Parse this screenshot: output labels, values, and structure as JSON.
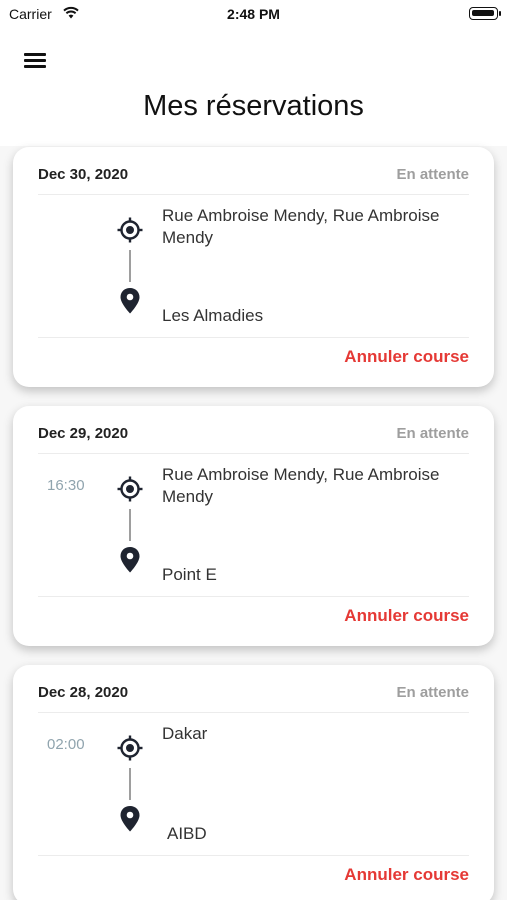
{
  "status_bar": {
    "carrier": "Carrier",
    "time": "2:48 PM"
  },
  "header": {
    "title": "Mes réservations"
  },
  "reservations": [
    {
      "date": "Dec 30, 2020",
      "status": "En attente",
      "time": "",
      "origin": "Rue Ambroise Mendy, Rue Ambroise Mendy",
      "destination": "Les Almadies",
      "cancel_label": "Annuler course"
    },
    {
      "date": "Dec 29, 2020",
      "status": "En attente",
      "time": "16:30",
      "origin": "Rue Ambroise Mendy, Rue Ambroise Mendy",
      "destination": "Point E",
      "cancel_label": "Annuler course"
    },
    {
      "date": "Dec 28, 2020",
      "status": "En attente",
      "time": "02:00",
      "origin": "Dakar",
      "destination": "AIBD",
      "cancel_label": "Annuler course"
    }
  ],
  "colors": {
    "accent_cancel": "#e53935",
    "status_text": "#9e9e9e",
    "time_text": "#90a4ae",
    "icon": "#1f2430"
  },
  "icons": {
    "menu": "hamburger-icon",
    "origin": "crosshair-icon",
    "destination": "map-pin-icon"
  }
}
